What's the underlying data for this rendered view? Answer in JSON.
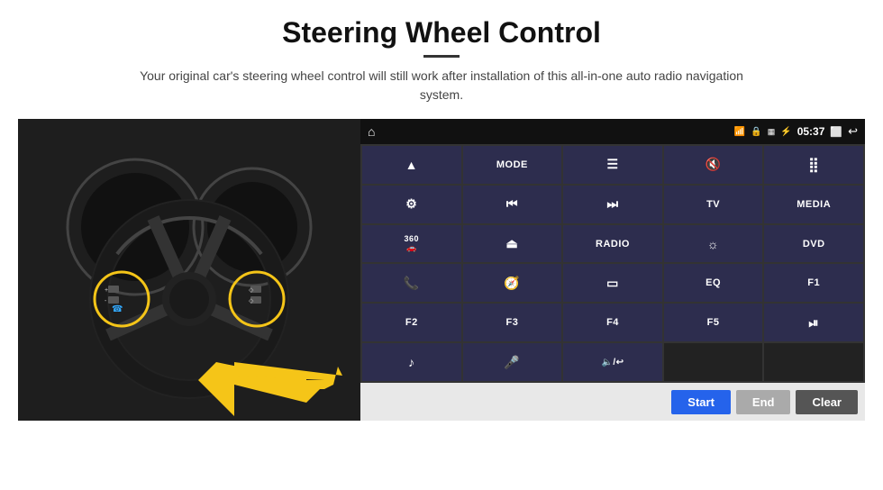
{
  "header": {
    "title": "Steering Wheel Control",
    "subtitle": "Your original car's steering wheel control will still work after installation of this all-in-one auto radio navigation system."
  },
  "statusBar": {
    "time": "05:37",
    "icons": [
      "wifi",
      "lock",
      "sd",
      "bluetooth",
      "window",
      "back"
    ]
  },
  "gridButtons": [
    {
      "id": "r1c1",
      "type": "icon",
      "symbol": "▲",
      "label": "navigate"
    },
    {
      "id": "r1c2",
      "label": "MODE"
    },
    {
      "id": "r1c3",
      "type": "icon",
      "symbol": "☰",
      "label": "menu"
    },
    {
      "id": "r1c4",
      "type": "icon",
      "symbol": "🔇",
      "label": "mute"
    },
    {
      "id": "r1c5",
      "type": "icon",
      "symbol": "⠿",
      "label": "apps"
    },
    {
      "id": "r2c1",
      "type": "icon",
      "symbol": "◎",
      "label": "settings"
    },
    {
      "id": "r2c2",
      "type": "icon",
      "symbol": "⏮",
      "label": "prev"
    },
    {
      "id": "r2c3",
      "type": "icon",
      "symbol": "⏭",
      "label": "next"
    },
    {
      "id": "r2c4",
      "label": "TV"
    },
    {
      "id": "r2c5",
      "label": "MEDIA"
    },
    {
      "id": "r3c1",
      "type": "icon",
      "symbol": "360",
      "label": "camera360"
    },
    {
      "id": "r3c2",
      "type": "icon",
      "symbol": "⏏",
      "label": "eject"
    },
    {
      "id": "r3c3",
      "label": "RADIO"
    },
    {
      "id": "r3c4",
      "type": "icon",
      "symbol": "☼",
      "label": "brightness"
    },
    {
      "id": "r3c5",
      "label": "DVD"
    },
    {
      "id": "r4c1",
      "type": "icon",
      "symbol": "📞",
      "label": "call"
    },
    {
      "id": "r4c2",
      "type": "icon",
      "symbol": "◎",
      "label": "navigation"
    },
    {
      "id": "r4c3",
      "type": "icon",
      "symbol": "▭",
      "label": "screen"
    },
    {
      "id": "r4c4",
      "label": "EQ"
    },
    {
      "id": "r4c5",
      "label": "F1"
    },
    {
      "id": "r5c1",
      "label": "F2"
    },
    {
      "id": "r5c2",
      "label": "F3"
    },
    {
      "id": "r5c3",
      "label": "F4"
    },
    {
      "id": "r5c4",
      "label": "F5"
    },
    {
      "id": "r5c5",
      "type": "icon",
      "symbol": "⏯",
      "label": "play-pause"
    },
    {
      "id": "r6c1",
      "type": "icon",
      "symbol": "♪",
      "label": "music"
    },
    {
      "id": "r6c2",
      "type": "icon",
      "symbol": "🎤",
      "label": "mic"
    },
    {
      "id": "r6c3",
      "type": "icon",
      "symbol": "🔈/↩",
      "label": "volume-back"
    },
    {
      "id": "r6c4",
      "label": ""
    },
    {
      "id": "r6c5",
      "label": ""
    }
  ],
  "bottomBar": {
    "startLabel": "Start",
    "endLabel": "End",
    "clearLabel": "Clear"
  }
}
